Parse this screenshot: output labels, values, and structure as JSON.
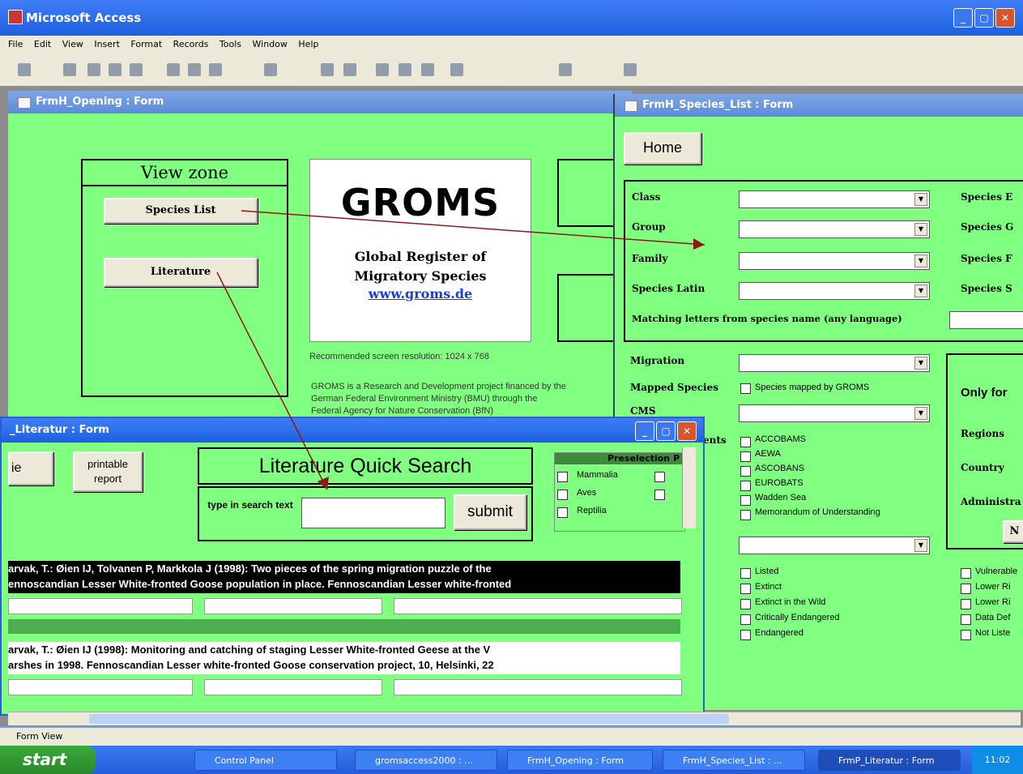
{
  "app": {
    "title": "Microsoft Access"
  },
  "menu": [
    "File",
    "Edit",
    "View",
    "Insert",
    "Format",
    "Records",
    "Tools",
    "Window",
    "Help"
  ],
  "opening_form": {
    "title": "FrmH_Opening : Form",
    "view_zone": "View zone",
    "species_btn": "Species List",
    "literature_btn": "Literature",
    "groms_logo": "GROMS",
    "groms_sub1": "Global Register of",
    "groms_sub2": "Migratory Species",
    "groms_url": "www.groms.de",
    "resolution": "Recommended screen resolution: 1024 x 768",
    "project_text1": "GROMS is a Research and Development project financed by the",
    "project_text2": "German Federal Environment Ministry (BMU) through the",
    "project_text3": "Federal Agency for Nature Conservation (BfN)"
  },
  "species_form": {
    "title": "FrmH_Species_List : Form",
    "home": "Home",
    "class_lbl": "Class",
    "group_lbl": "Group",
    "family_lbl": "Family",
    "species_latin_lbl": "Species Latin",
    "matching_lbl": "Matching letters from species name (any language)",
    "species_e": "Species E",
    "species_g": "Species G",
    "species_f": "Species F",
    "species_s": "Species S",
    "migration_lbl": "Migration",
    "mapped_lbl": "Mapped Species",
    "mapped_cb": "Species mapped by GROMS",
    "cms_lbl": "CMS",
    "agreements_lbl": "ents",
    "agreements": [
      "ACCOBAMS",
      "AEWA",
      "ASCOBANS",
      "EUROBATS",
      "Wadden Sea",
      "Memorandum of Understanding"
    ],
    "redlist": [
      "Listed",
      "Extinct",
      "Extinct in the Wild",
      "Critically Endangered",
      "Endangered"
    ],
    "redlist2": [
      "Vulnerable",
      "Lower Ri",
      "Lower Ri",
      "Data Def",
      "Not Liste"
    ],
    "only_for": "Only for",
    "regions": "Regions",
    "country": "Country",
    "admin": "Administra",
    "n_btn": "N"
  },
  "literatur_form": {
    "title": "_Literatur : Form",
    "home_partial": "ie",
    "printable": "printable report",
    "quick_search": "Literature Quick Search",
    "search_label": "type in search text",
    "submit": "submit",
    "presel_title": "Preselection P",
    "presel": [
      "Mammalia",
      "Aves",
      "Reptilia"
    ],
    "record1_line1": "arvak, T.: Øien IJ, Tolvanen P, Markkola J (1998): Two pieces of the spring migration puzzle of the",
    "record1_line2": "ennoscandian Lesser White-fronted Goose population in place. Fennoscandian Lesser white-fronted",
    "record2_line1": "arvak, T.: Øien IJ (1998): Monitoring and catching of staging Lesser White-fronted Geese at the V",
    "record2_line2": "arshes in 1998. Fennoscandian Lesser white-fronted Goose conservation project, 10, Helsinki, 22"
  },
  "status": "Form View",
  "taskbar": {
    "start": "start",
    "tasks": [
      "Control Panel",
      "gromsaccess2000 : ...",
      "FrmH_Opening : Form",
      "FrmH_Species_List : ...",
      "FrmP_Literatur : Form"
    ],
    "clock": "11:02"
  }
}
